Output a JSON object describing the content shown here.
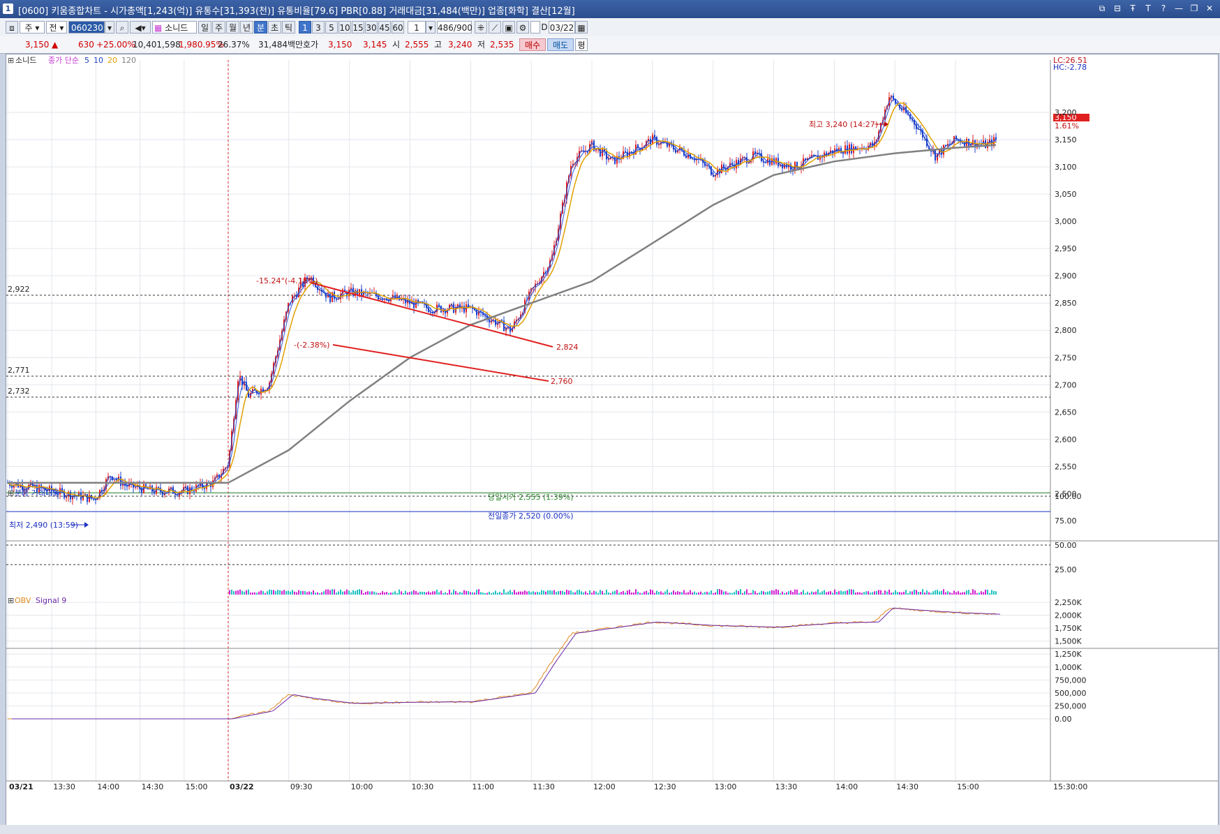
{
  "window": {
    "title": "[0600] 키움종합차트 - 시가총액[1,243(억)] 유통수[31,393(천)] 유통비율[79.6] PBR[0.88] 거래대금[31,484(백만)] 업종[화학] 결산[12월]",
    "icon_label": "1",
    "icons": [
      "window-icon",
      "pin-icon",
      "t-icon",
      "t-icon",
      "minimize-icon",
      "restore-icon",
      "close-icon"
    ]
  },
  "toolbar": {
    "period_select": "주",
    "market_select": "전",
    "stock_code": "060230",
    "stock_name": "소니드",
    "interval_buttons": [
      "일",
      "주",
      "월",
      "년",
      "분",
      "초",
      "틱"
    ],
    "interval_selected": "분",
    "minute_buttons": [
      "1",
      "3",
      "5",
      "10",
      "15",
      "30",
      "45",
      "60"
    ],
    "minute_selected": "1",
    "count_value": "1",
    "bars_display": "486/900",
    "date_value": "03/22"
  },
  "quote": {
    "price": "3,150",
    "up_arrow": "▲",
    "change": "630",
    "change_pct": "+25.00%",
    "volume": "10,401,598",
    "volume_ratio": "1,980.95%",
    "turnover": "26.37%",
    "trade_value": "31,484백만",
    "bid_label": "호가",
    "ask_price": "3,150",
    "bid_price": "3,145",
    "open_label": "시",
    "open": "2,555",
    "high_label": "고",
    "high": "3,240",
    "low_label": "저",
    "low": "2,535",
    "buy_button": "매수",
    "sell_button": "매도",
    "flat_button": "평"
  },
  "price_panel": {
    "name_tag": "소니드",
    "legend_ma_label": "종가 단순",
    "legend_ma_periods": [
      "5",
      "10",
      "20",
      "120"
    ],
    "legend_colors": [
      "#1f3fbf",
      "#1f3fbf",
      "#e0a000",
      "#808080"
    ],
    "lc_label": "LC:26.51",
    "hc_label": "HC:-2.78",
    "current_price_tag": "3,150",
    "current_pct_tag": "1.61%",
    "high_annotation": "최고 3,240 (14:27)",
    "low_annotation": "최저 2,490 (13:59)",
    "open_line_label": "당일시가 2,555 (1.39%)",
    "prev_close_label": "전일종가 2,520 (0.00%)",
    "hline_labels": [
      "2,922",
      "2,771",
      "2,732"
    ],
    "trend_top_label": "-15.24°(-4.18%)",
    "trend_bottom_label": "-(-2.38%)",
    "trend_top_end_label": "2,824",
    "trend_bottom_end_label": "2,760",
    "y_ticks": [
      "3,200",
      "3,150",
      "3,100",
      "3,050",
      "3,000",
      "2,950",
      "2,900",
      "2,850",
      "2,800",
      "2,750",
      "2,700",
      "2,650",
      "2,600",
      "2,550",
      "2,500"
    ]
  },
  "volume_panel": {
    "title": "분봉 거래대금",
    "y_ticks": [
      "100.00",
      "75.00",
      "50.00",
      "25.00"
    ]
  },
  "obv_panel": {
    "label_obv": "OBV",
    "label_signal": "Signal 9",
    "y_ticks": [
      "2,250K",
      "2,000K",
      "1,750K",
      "1,500K",
      "1,250K",
      "1,000K",
      "750,000",
      "500,000",
      "250,000",
      "0.00"
    ]
  },
  "x_axis": {
    "labels": [
      "03/21",
      "13:30",
      "14:00",
      "14:30",
      "15:00",
      "03/22",
      "09:30",
      "10:00",
      "10:30",
      "11:00",
      "11:30",
      "12:00",
      "12:30",
      "13:00",
      "13:30",
      "14:00",
      "14:30",
      "15:00"
    ],
    "right_label": "15:30:00"
  },
  "chart_data": {
    "type": "candlestick",
    "interval": "1분",
    "ylim": [
      2480,
      3250
    ],
    "session_breaks": [
      "03/22"
    ],
    "price_path": [
      [
        "03/21 13:00",
        2520
      ],
      [
        "03/21 13:30",
        2505
      ],
      [
        "03/21 13:59",
        2490
      ],
      [
        "03/21 14:10",
        2535
      ],
      [
        "03/21 14:20",
        2515
      ],
      [
        "03/21 14:40",
        2505
      ],
      [
        "03/21 15:00",
        2505
      ],
      [
        "03/21 15:20",
        2520
      ],
      [
        "03/22 09:00",
        2555
      ],
      [
        "03/22 09:05",
        2720
      ],
      [
        "03/22 09:10",
        2680
      ],
      [
        "03/22 09:20",
        2700
      ],
      [
        "03/22 09:30",
        2850
      ],
      [
        "03/22 09:40",
        2900
      ],
      [
        "03/22 09:50",
        2860
      ],
      [
        "03/22 10:00",
        2870
      ],
      [
        "03/22 10:20",
        2860
      ],
      [
        "03/22 10:40",
        2840
      ],
      [
        "03/22 11:00",
        2840
      ],
      [
        "03/22 11:20",
        2800
      ],
      [
        "03/22 11:30",
        2870
      ],
      [
        "03/22 11:40",
        2930
      ],
      [
        "03/22 11:50",
        3110
      ],
      [
        "03/22 12:00",
        3140
      ],
      [
        "03/22 12:10",
        3110
      ],
      [
        "03/22 12:30",
        3150
      ],
      [
        "03/22 12:50",
        3120
      ],
      [
        "03/22 13:00",
        3090
      ],
      [
        "03/22 13:20",
        3120
      ],
      [
        "03/22 13:40",
        3100
      ],
      [
        "03/22 14:00",
        3130
      ],
      [
        "03/22 14:20",
        3140
      ],
      [
        "03/22 14:27",
        3230
      ],
      [
        "03/22 14:40",
        3180
      ],
      [
        "03/22 14:50",
        3120
      ],
      [
        "03/22 15:00",
        3150
      ],
      [
        "03/22 15:15",
        3140
      ],
      [
        "03/22 15:20",
        3150
      ]
    ],
    "ma120_path": [
      [
        "03/22 09:00",
        2520
      ],
      [
        "03/22 09:30",
        2580
      ],
      [
        "03/22 10:00",
        2670
      ],
      [
        "03/22 10:30",
        2750
      ],
      [
        "03/22 11:00",
        2810
      ],
      [
        "03/22 11:30",
        2850
      ],
      [
        "03/22 12:00",
        2890
      ],
      [
        "03/22 12:30",
        2960
      ],
      [
        "03/22 13:00",
        3030
      ],
      [
        "03/22 13:30",
        3085
      ],
      [
        "03/22 14:00",
        3110
      ],
      [
        "03/22 14:30",
        3125
      ],
      [
        "03/22 15:00",
        3135
      ],
      [
        "03/22 15:20",
        3140
      ]
    ],
    "obv_path": [
      [
        "03/21 13:00",
        0
      ],
      [
        "03/22 09:00",
        0
      ],
      [
        "03/22 09:20",
        150000
      ],
      [
        "03/22 09:30",
        470000
      ],
      [
        "03/22 09:40",
        400000
      ],
      [
        "03/22 10:00",
        300000
      ],
      [
        "03/22 10:30",
        320000
      ],
      [
        "03/22 11:00",
        330000
      ],
      [
        "03/22 11:30",
        500000
      ],
      [
        "03/22 11:40",
        1100000
      ],
      [
        "03/22 11:50",
        1650000
      ],
      [
        "03/22 12:30",
        1870000
      ],
      [
        "03/22 13:00",
        1800000
      ],
      [
        "03/22 13:30",
        1770000
      ],
      [
        "03/22 14:00",
        1850000
      ],
      [
        "03/22 14:20",
        1870000
      ],
      [
        "03/22 14:27",
        2140000
      ],
      [
        "03/22 14:40",
        2100000
      ],
      [
        "03/22 15:00",
        2050000
      ],
      [
        "03/22 15:20",
        2020000
      ]
    ]
  }
}
